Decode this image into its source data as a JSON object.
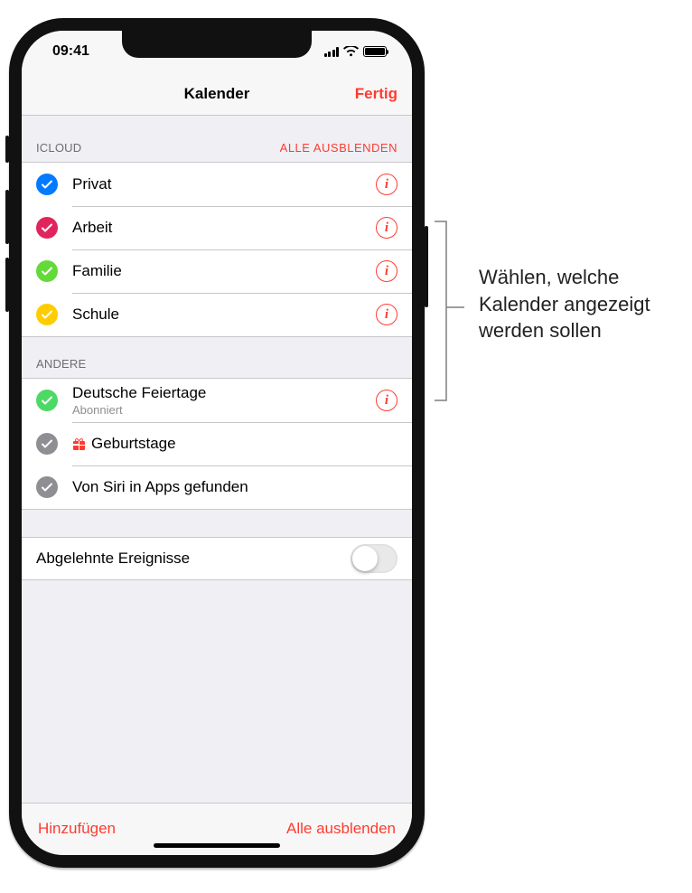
{
  "status": {
    "time": "09:41"
  },
  "nav": {
    "title": "Kalender",
    "done": "Fertig"
  },
  "sections": {
    "icloud": {
      "header": "ICLOUD",
      "action": "ALLE AUSBLENDEN",
      "items": [
        {
          "label": "Privat",
          "color": "#007aff"
        },
        {
          "label": "Arbeit",
          "color": "#e2245e"
        },
        {
          "label": "Familie",
          "color": "#63da38"
        },
        {
          "label": "Schule",
          "color": "#ffcc00"
        }
      ]
    },
    "other": {
      "header": "ANDERE",
      "items": [
        {
          "label": "Deutsche Feiertage",
          "sub": "Abonniert",
          "color": "#4cd964",
          "info": true
        },
        {
          "label": "Geburtstage",
          "color": "#8e8e93",
          "gift": true
        },
        {
          "label": "Von Siri in Apps gefunden",
          "color": "#8e8e93"
        }
      ]
    }
  },
  "declined": {
    "label": "Abgelehnte Ereignisse"
  },
  "toolbar": {
    "add": "Hinzufügen",
    "hideAll": "Alle ausblenden"
  },
  "callout": "Wählen, welche Kalender angezeigt werden sollen"
}
